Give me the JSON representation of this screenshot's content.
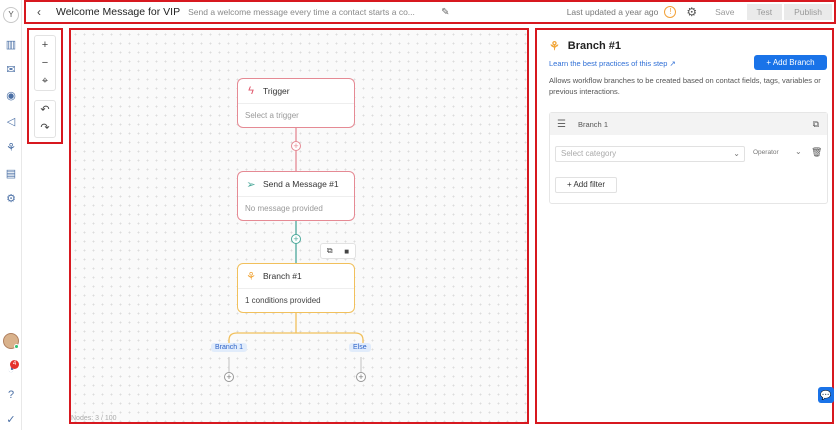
{
  "rail": {
    "logo": "Y",
    "notification_count": "4"
  },
  "header": {
    "title": "Welcome Message for VIP",
    "description": "Send a welcome message every time a contact starts a co...",
    "last_updated": "Last updated a year ago",
    "save_label": "Save",
    "test_label": "Test",
    "publish_label": "Publish"
  },
  "zoom": {
    "zoom_in": "+",
    "zoom_out": "−",
    "fit": "⌖",
    "undo": "↶",
    "redo": "↷"
  },
  "canvas": {
    "nodes": [
      {
        "title": "Trigger",
        "body": "Select a trigger",
        "icon": "lightning-icon"
      },
      {
        "title": "Send a Message #1",
        "body": "No message provided",
        "icon": "send-icon"
      },
      {
        "title": "Branch #1",
        "body": "1 conditions provided",
        "icon": "branch-icon"
      }
    ],
    "branches": [
      {
        "label": "Branch 1"
      },
      {
        "label": "Else"
      }
    ],
    "nodes_count": "Nodes: 3 / 100"
  },
  "panel": {
    "title": "Branch #1",
    "learn_link": "Learn the best practices of this step",
    "add_branch_label": "+ Add Branch",
    "description": "Allows workflow branches to be created based on contact fields, tags, variables or previous interactions.",
    "branch_card": {
      "name": "Branch 1",
      "category_placeholder": "Select category",
      "operator_label": "Operator",
      "add_filter_label": "+ Add filter"
    }
  },
  "colors": {
    "accent": "#1a73e8",
    "trigger_border": "#e58a94",
    "branch_border": "#f1c05c",
    "connector_teal": "#4aa89a",
    "annotation_red": "#d7181f"
  }
}
